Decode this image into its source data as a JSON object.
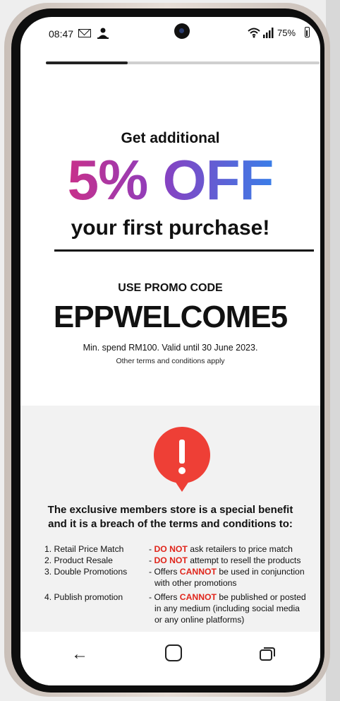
{
  "status_bar": {
    "time": "08:47",
    "battery": "75%"
  },
  "progress": {
    "fraction": 0.3
  },
  "promo": {
    "intro": "Get additional",
    "discount": "5% OFF",
    "subtitle": "your first purchase!",
    "use_code_label": "USE PROMO CODE",
    "code": "EPPWELCOME5",
    "min_spend": "Min. spend RM100. Valid until 30 June 2023.",
    "terms_note": "Other terms and conditions apply"
  },
  "warning": {
    "headline_line1": "The exclusive members store is a special benefit",
    "headline_line2": "and it is a breach of the terms and conditions to:",
    "rules": [
      {
        "label": "1. Retail Price Match",
        "prefix": "- ",
        "emph": "DO NOT",
        "rest": " ask retailers to price match"
      },
      {
        "label": "2. Product Resale",
        "prefix": "- ",
        "emph": "DO NOT",
        "rest": " attempt to resell the products"
      },
      {
        "label": "3. Double Promotions",
        "prefix": "- Offers ",
        "emph": "CANNOT",
        "rest": " be used in conjunction",
        "more": "with other promotions"
      },
      {
        "label": "4. Publish promotion",
        "prefix": "- Offers ",
        "emph": "CANNOT",
        "rest": " be published or posted",
        "more": "in any medium (including social media",
        "more2": "or any online platforms)"
      }
    ]
  },
  "nav": {
    "back": "←"
  },
  "colors": {
    "accent_red": "#e0261c",
    "gradient_start": "#c8308a",
    "gradient_end": "#3a7ee8"
  },
  "icons": [
    "mail-icon",
    "person-icon",
    "wifi-icon",
    "signal-icon",
    "battery-icon",
    "alert-icon",
    "back-icon",
    "home-icon",
    "recent-apps-icon"
  ]
}
